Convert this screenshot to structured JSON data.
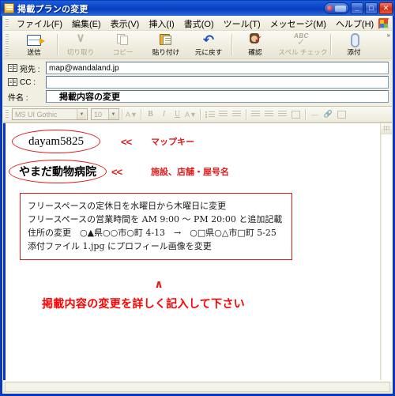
{
  "window": {
    "title": "掲載プランの変更",
    "title_icon": "mail-window-icon",
    "buttons": {
      "help_pill": "help-pill-button",
      "minimize": "_",
      "maximize": "□",
      "close": "✕"
    }
  },
  "menubar": {
    "items": [
      {
        "label": "ファイル(F)",
        "name": "menu-file"
      },
      {
        "label": "編集(E)",
        "name": "menu-edit"
      },
      {
        "label": "表示(V)",
        "name": "menu-view"
      },
      {
        "label": "挿入(I)",
        "name": "menu-insert"
      },
      {
        "label": "書式(O)",
        "name": "menu-format"
      },
      {
        "label": "ツール(T)",
        "name": "menu-tools"
      },
      {
        "label": "メッセージ(M)",
        "name": "menu-message"
      },
      {
        "label": "ヘルプ(H)",
        "name": "menu-help"
      }
    ]
  },
  "toolbar": {
    "buttons": [
      {
        "label": "送信",
        "icon": "send-icon",
        "enabled": true
      },
      {
        "label": "切り取り",
        "icon": "cut-scissors-icon",
        "enabled": false
      },
      {
        "label": "コピー",
        "icon": "copy-pages-icon",
        "enabled": false
      },
      {
        "label": "貼り付け",
        "icon": "paste-clipboard-icon",
        "enabled": true
      },
      {
        "label": "元に戻す",
        "icon": "undo-arrow-icon",
        "enabled": true
      },
      {
        "label": "確認",
        "icon": "check-names-person-icon",
        "enabled": true
      },
      {
        "label": "スペル チェック",
        "icon": "spell-check-abc-icon",
        "enabled": false
      },
      {
        "label": "添付",
        "icon": "paperclip-attach-icon",
        "enabled": true
      }
    ],
    "overflow_chevron": "»"
  },
  "headers": {
    "to": {
      "label": "宛先 :",
      "value": "map@wandaland.jp",
      "icon": "address-book-icon"
    },
    "cc": {
      "label": "CC :",
      "value": "",
      "icon": "address-book-icon"
    },
    "subject": {
      "label": "件名 :",
      "value": "掲載内容の変更"
    }
  },
  "format_toolbar": {
    "font_name": "MS UI Gothic",
    "font_size": "10",
    "buttons": [
      {
        "name": "font-color-button",
        "glyph": "A"
      },
      {
        "name": "bold-button",
        "glyph": "B"
      },
      {
        "name": "italic-button",
        "glyph": "I"
      },
      {
        "name": "underline-button",
        "glyph": "U"
      },
      {
        "name": "text-highlight-button",
        "glyph": "A"
      },
      {
        "name": "numbered-list-button",
        "glyph": ""
      },
      {
        "name": "decrease-indent-button",
        "glyph": ""
      },
      {
        "name": "increase-indent-button",
        "glyph": ""
      },
      {
        "name": "align-left-button",
        "glyph": ""
      },
      {
        "name": "align-center-button",
        "glyph": ""
      },
      {
        "name": "align-right-button",
        "glyph": ""
      },
      {
        "name": "justify-button",
        "glyph": ""
      },
      {
        "name": "horizontal-rule-button",
        "glyph": "—"
      },
      {
        "name": "insert-link-button",
        "glyph": ""
      },
      {
        "name": "insert-image-button",
        "glyph": ""
      }
    ]
  },
  "body": {
    "annotations": [
      {
        "oval_text": "dayam5825",
        "arrows": "<<",
        "label": "マップキー"
      },
      {
        "oval_text": "やまだ動物病院",
        "arrows": "<<",
        "label": "施設、店舗・屋号名"
      }
    ],
    "detail_box": {
      "lines": [
        "フリースペースの定休日を水曜日から木曜日に変更",
        "フリースペースの営業時間を AM 9:00 ～ PM 20:00 と追加記載",
        "住所の変更　○▲県○○市○町 4-13　→　○□県○△市□町 5-25",
        "添付ファイル 1.jpg にプロフィール画像を変更"
      ]
    },
    "caret": "∧",
    "caption": "掲載内容の変更を詳しく記入して下さい"
  },
  "colors": {
    "annotation_red": "#e01b1b",
    "caption_red": "#ff0000",
    "titlebar_blue": "#0a43c8",
    "toolbar_beige": "#f1efe2"
  }
}
